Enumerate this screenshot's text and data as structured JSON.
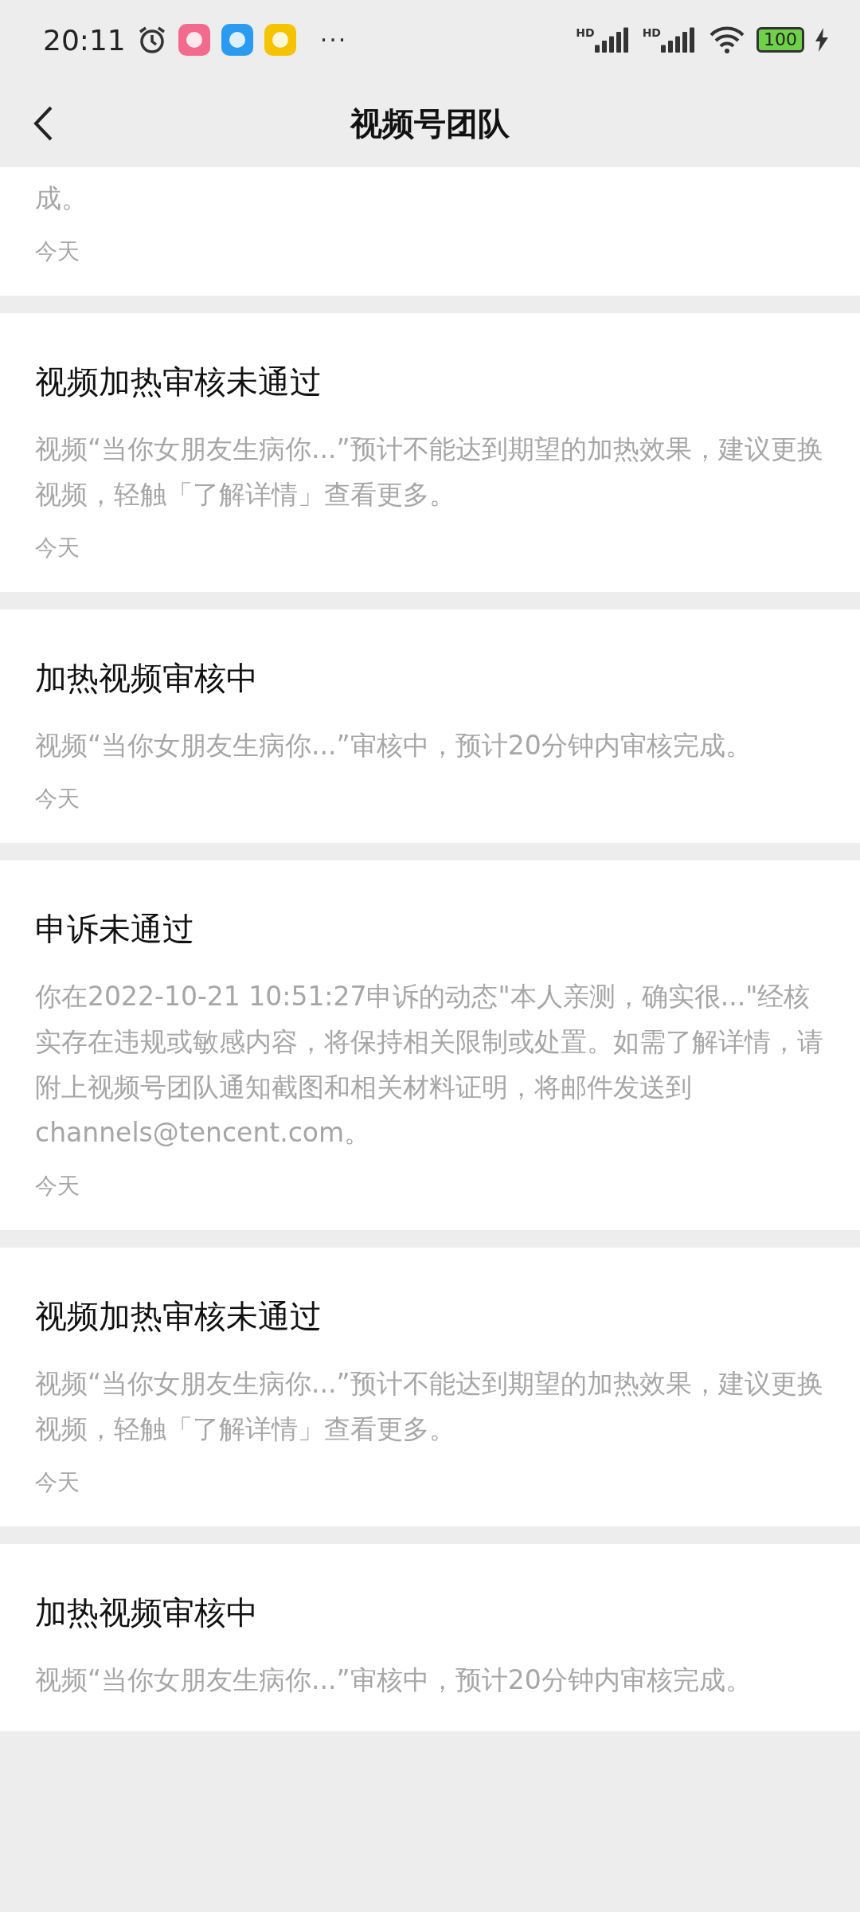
{
  "status_bar": {
    "time": "20:11",
    "more": "···",
    "signal_labels": [
      "HD",
      "HD"
    ],
    "battery": "100"
  },
  "nav": {
    "title": "视频号团队"
  },
  "messages": [
    {
      "kind": "partial",
      "body": "成。",
      "time": "今天"
    },
    {
      "kind": "full",
      "title": "视频加热审核未通过",
      "body": "视频“当你女朋友生病你...”预计不能达到期望的加热效果，建议更换视频，轻触「了解详情」查看更多。",
      "time": "今天"
    },
    {
      "kind": "full",
      "title": "加热视频审核中",
      "body": "视频“当你女朋友生病你...”审核中，预计20分钟内审核完成。",
      "time": "今天"
    },
    {
      "kind": "full",
      "title": "申诉未通过",
      "body": "你在2022-10-21 10:51:27申诉的动态\"本人亲测，确实很...\"经核实存在违规或敏感内容，将保持相关限制或处置。如需了解详情，请附上视频号团队通知截图和相关材料证明，将邮件发送到channels@tencent.com。",
      "time": "今天"
    },
    {
      "kind": "full",
      "title": "视频加热审核未通过",
      "body": "视频“当你女朋友生病你...”预计不能达到期望的加热效果，建议更换视频，轻触「了解详情」查看更多。",
      "time": "今天"
    },
    {
      "kind": "full",
      "title": "加热视频审核中",
      "body": "视频“当你女朋友生病你...”审核中，预计20分钟内审核完成。"
    }
  ]
}
